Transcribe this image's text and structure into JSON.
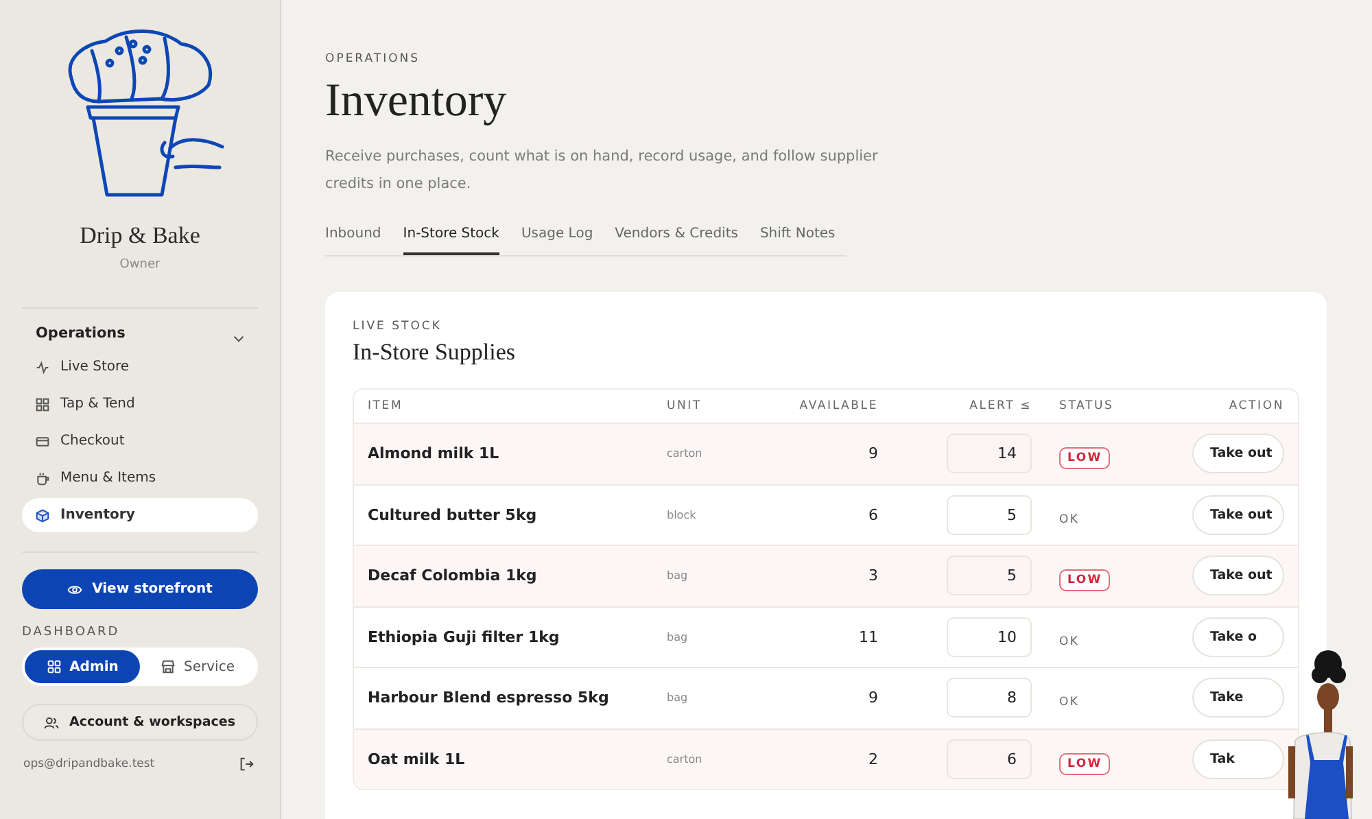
{
  "sidebar": {
    "brand": "Drip & Bake",
    "role": "Owner",
    "nav_group": {
      "label": "Operations",
      "expanded": true,
      "items": [
        {
          "label": "Live Store",
          "selected": false
        },
        {
          "label": "Tap & Tend",
          "selected": false
        },
        {
          "label": "Checkout",
          "selected": false
        },
        {
          "label": "Menu & Items",
          "selected": false
        },
        {
          "label": "Inventory",
          "selected": true
        }
      ]
    },
    "storefront_button": "View storefront",
    "dashboard": {
      "label": "DASHBOARD",
      "options": [
        {
          "label": "Admin",
          "selected": true
        },
        {
          "label": "Service",
          "selected": false
        }
      ]
    },
    "account_button": "Account & workspaces",
    "email": "ops@dripandbake.test"
  },
  "header": {
    "eyebrow": "OPERATIONS",
    "title": "Inventory",
    "description": "Receive purchases, count what is on hand, record usage, and follow supplier credits in one place."
  },
  "tabs": [
    {
      "label": "Inbound",
      "selected": false
    },
    {
      "label": "In-Store Stock",
      "selected": true
    },
    {
      "label": "Usage Log",
      "selected": false
    },
    {
      "label": "Vendors & Credits",
      "selected": false
    },
    {
      "label": "Shift Notes",
      "selected": false
    }
  ],
  "card": {
    "eyebrow": "LIVE STOCK",
    "title": "In-Store Supplies",
    "table": {
      "columns": [
        "ITEM",
        "UNIT",
        "AVAILABLE",
        "ALERT ≤",
        "STATUS",
        "ACTION"
      ],
      "rows": [
        {
          "item": "Almond milk 1L",
          "unit": "carton",
          "available": "9",
          "alert": "14",
          "status": "LOW",
          "low": true,
          "action": "Take out"
        },
        {
          "item": "Cultured butter 5kg",
          "unit": "block",
          "available": "6",
          "alert": "5",
          "status": "OK",
          "low": false,
          "action": "Take out"
        },
        {
          "item": "Decaf Colombia 1kg",
          "unit": "bag",
          "available": "3",
          "alert": "5",
          "status": "LOW",
          "low": true,
          "action": "Take out"
        },
        {
          "item": "Ethiopia Guji filter 1kg",
          "unit": "bag",
          "available": "11",
          "alert": "10",
          "status": "OK",
          "low": false,
          "action": "Take o"
        },
        {
          "item": "Harbour Blend espresso 5kg",
          "unit": "bag",
          "available": "9",
          "alert": "8",
          "status": "OK",
          "low": false,
          "action": "Take"
        },
        {
          "item": "Oat milk 1L",
          "unit": "carton",
          "available": "2",
          "alert": "6",
          "status": "LOW",
          "low": true,
          "action": "Tak"
        }
      ]
    }
  }
}
